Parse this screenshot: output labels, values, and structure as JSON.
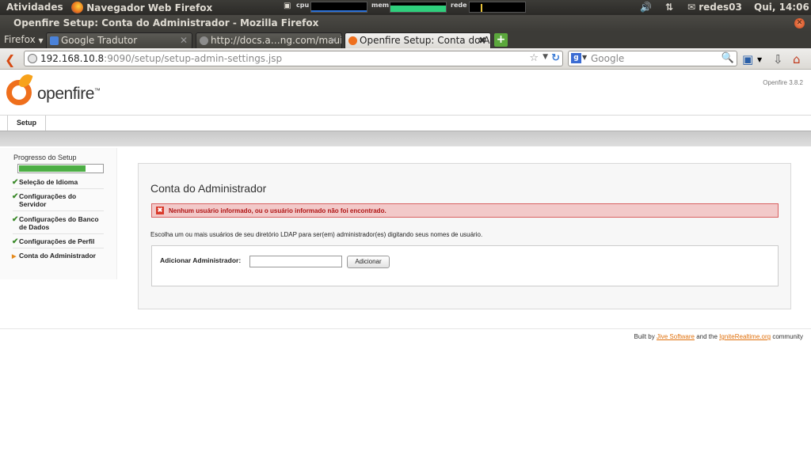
{
  "top_panel": {
    "activities": "Atividades",
    "app_name": "Navegador Web Firefox",
    "cpu_label": "cpu",
    "mem_label": "mem",
    "net_label": "rede",
    "user": "redes03",
    "clock": "Qui, 14:06"
  },
  "window": {
    "title": "Openfire Setup: Conta do Administrador - Mozilla Firefox"
  },
  "tabs": {
    "menu_label": "Firefox",
    "items": [
      {
        "label": "Google Tradutor",
        "active": false
      },
      {
        "label": "http://docs.a…ng.com/maui/",
        "active": false
      },
      {
        "label": "Openfire Setup: Conta do A…",
        "active": true
      }
    ],
    "new_tab": "+"
  },
  "nav": {
    "url_host": "192.168.10.8",
    "url_rest": ":9090/setup/setup-admin-settings.jsp",
    "search_placeholder": "Google"
  },
  "openfire": {
    "logo_text": "openfire",
    "logo_tm": "™",
    "version": "Openfire 3.8.2",
    "top_tab": "Setup"
  },
  "sidebar": {
    "title": "Progresso do Setup",
    "progress": 0.8,
    "steps": [
      {
        "label": "Seleção de Idioma",
        "done": true
      },
      {
        "label": "Configurações do Servidor",
        "done": true
      },
      {
        "label": "Configurações do Banco de Dados",
        "done": true
      },
      {
        "label": "Configurações de Perfil",
        "done": true
      },
      {
        "label": "Conta do Administrador",
        "done": false
      }
    ]
  },
  "content": {
    "title": "Conta do Administrador",
    "error": "Nenhum usuário informado, ou o usuário informado não foi encontrado.",
    "instructions": "Escolha um ou mais usuários de seu diretório LDAP para ser(em) administrador(es) digitando seus nomes de usuário.",
    "form_label": "Adicionar Administrador:",
    "input_value": "",
    "add_button": "Adicionar"
  },
  "footer": {
    "built_by": "Built by",
    "jive": "Jive Software",
    "and_the": "and the",
    "ignite": "IgniteRealtime.org",
    "community": "community"
  },
  "colors": {
    "accent": "#e0710d",
    "error_bg": "#f2c9c9",
    "progress": "#4dae45"
  }
}
